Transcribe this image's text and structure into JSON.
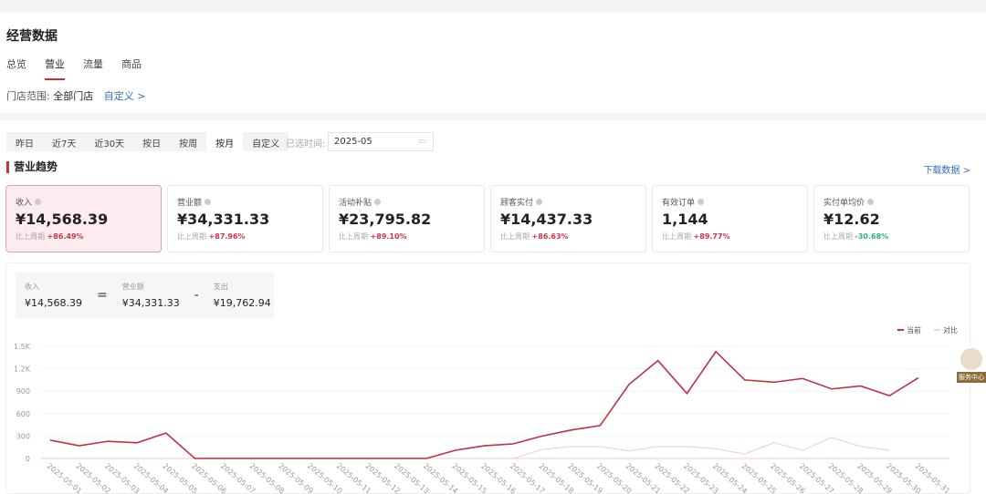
{
  "header": {
    "title": "经营数据",
    "tabs": [
      {
        "label": "总览"
      },
      {
        "label": "营业",
        "active": true
      },
      {
        "label": "流量"
      },
      {
        "label": "商品"
      }
    ],
    "store_label": "门店范围:",
    "store_value": "全部门店",
    "custom_link": "自定义 >"
  },
  "filters": {
    "ranges": [
      "昨日",
      "近7天",
      "近30天",
      "按日",
      "按周",
      "按月",
      "自定义"
    ],
    "active": "按月",
    "selected_label": "已选时间:",
    "selected_value": "2025-05",
    "calendar_icon": "calendar-icon"
  },
  "section": {
    "title": "营业趋势",
    "download": "下载数据 >"
  },
  "cards": [
    {
      "label": "收入",
      "value": "¥14,568.39",
      "compare_label": "比上周期",
      "change": "+86.49%",
      "active": true
    },
    {
      "label": "营业额",
      "value": "¥34,331.33",
      "compare_label": "比上周期",
      "change": "+87.96%"
    },
    {
      "label": "活动补贴",
      "value": "¥23,795.82",
      "compare_label": "比上周期",
      "change": "+89.10%"
    },
    {
      "label": "顾客实付",
      "value": "¥14,437.33",
      "compare_label": "比上周期",
      "change": "+86.63%"
    },
    {
      "label": "有效订单",
      "value": "1,144",
      "compare_label": "比上周期",
      "change": "+89.77%"
    },
    {
      "label": "实付单均价",
      "value": "¥12.62",
      "compare_label": "比上周期",
      "change": "-30.68%"
    }
  ],
  "formula": {
    "a_label": "收入",
    "a_value": "¥14,568.39",
    "eq": "=",
    "b_label": "营业额",
    "b_value": "¥34,331.33",
    "minus": "-",
    "c_label": "支出",
    "c_value": "¥19,762.94"
  },
  "helper": {
    "label": "服务中心"
  },
  "colors": {
    "accent": "#c9303e",
    "current": "#c0303f",
    "compare": "#f2d3d8",
    "up": "#d1344a",
    "down": "#2bb37a"
  },
  "chart_data": {
    "type": "line",
    "categories": [
      "2025-05-01",
      "2025-05-02",
      "2025-05-03",
      "2025-05-04",
      "2025-05-05",
      "2025-05-06",
      "2025-05-07",
      "2025-05-08",
      "2025-05-09",
      "2025-05-10",
      "2025-05-11",
      "2025-05-12",
      "2025-05-13",
      "2025-05-14",
      "2025-05-15",
      "2025-05-16",
      "2025-05-17",
      "2025-05-18",
      "2025-05-19",
      "2025-05-20",
      "2025-05-21",
      "2025-05-22",
      "2025-05-23",
      "2025-05-24",
      "2025-05-25",
      "2025-05-26",
      "2025-05-27",
      "2025-05-28",
      "2025-05-29",
      "2025-05-30",
      "2025-05-31"
    ],
    "series": [
      {
        "name": "当前",
        "values": [
          245,
          170,
          230,
          210,
          340,
          0,
          0,
          0,
          0,
          0,
          0,
          0,
          0,
          0,
          110,
          170,
          195,
          300,
          380,
          440,
          990,
          1310,
          870,
          1430,
          1050,
          1020,
          1070,
          930,
          970,
          840,
          1080
        ]
      },
      {
        "name": "对比",
        "values": [
          0,
          0,
          0,
          0,
          0,
          0,
          0,
          0,
          0,
          0,
          0,
          0,
          0,
          0,
          0,
          0,
          0,
          120,
          160,
          160,
          100,
          160,
          160,
          130,
          60,
          210,
          110,
          280,
          160,
          110,
          null
        ]
      }
    ],
    "yticks": [
      "0",
      "300",
      "600",
      "900",
      "1.2K",
      "1.5K"
    ],
    "ylim": [
      0,
      1500
    ],
    "legend": "top-right",
    "grid": true
  }
}
